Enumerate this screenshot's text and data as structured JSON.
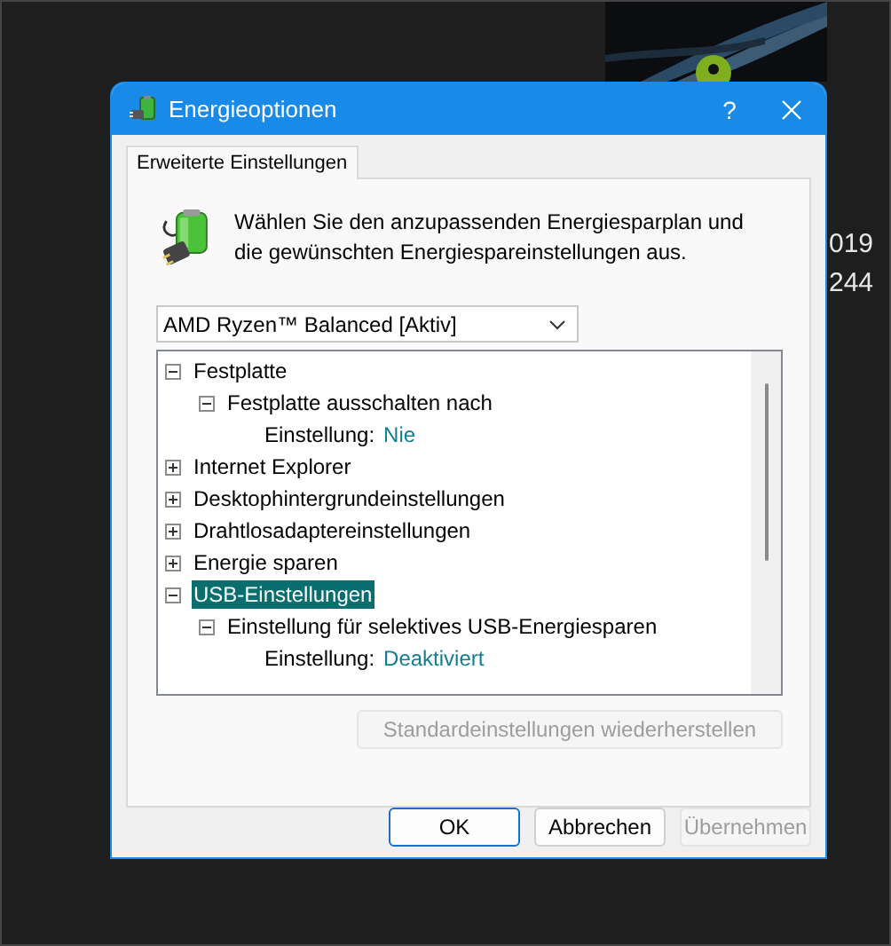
{
  "desktop": {
    "texts": [
      "019",
      "244"
    ]
  },
  "window": {
    "title": "Energieoptionen",
    "help": "?"
  },
  "tabs": [
    {
      "label": "Erweiterte Einstellungen",
      "selected": true
    }
  ],
  "intro": "Wählen Sie den anzupassenden Energiesparplan und die gewünschten Energiespareinstellungen aus.",
  "plan_dropdown": {
    "value": "AMD Ryzen™ Balanced [Aktiv]"
  },
  "tree": {
    "items": [
      {
        "kind": "group",
        "label": "Festplatte",
        "expanded": true,
        "selected": false,
        "children": [
          {
            "kind": "group",
            "label": "Festplatte ausschalten nach",
            "expanded": true,
            "selected": false,
            "children": [
              {
                "kind": "setting",
                "label": "Einstellung:",
                "value": "Nie"
              }
            ]
          }
        ]
      },
      {
        "kind": "group",
        "label": "Internet Explorer",
        "expanded": false,
        "selected": false
      },
      {
        "kind": "group",
        "label": "Desktophintergrundeinstellungen",
        "expanded": false,
        "selected": false
      },
      {
        "kind": "group",
        "label": "Drahtlosadaptereinstellungen",
        "expanded": false,
        "selected": false
      },
      {
        "kind": "group",
        "label": "Energie sparen",
        "expanded": false,
        "selected": false
      },
      {
        "kind": "group",
        "label": "USB-Einstellungen",
        "expanded": true,
        "selected": true,
        "children": [
          {
            "kind": "group",
            "label": "Einstellung für selektives USB-Energiesparen",
            "expanded": true,
            "selected": false,
            "children": [
              {
                "kind": "setting",
                "label": "Einstellung:",
                "value": "Deaktiviert"
              }
            ]
          }
        ]
      }
    ]
  },
  "restore_button": {
    "label": "Standardeinstellungen wiederherstellen",
    "disabled": true
  },
  "buttons": [
    {
      "label": "OK",
      "disabled": false,
      "default": true
    },
    {
      "label": "Abbrechen",
      "disabled": false,
      "default": false
    },
    {
      "label": "Übernehmen",
      "disabled": true,
      "default": false
    }
  ]
}
